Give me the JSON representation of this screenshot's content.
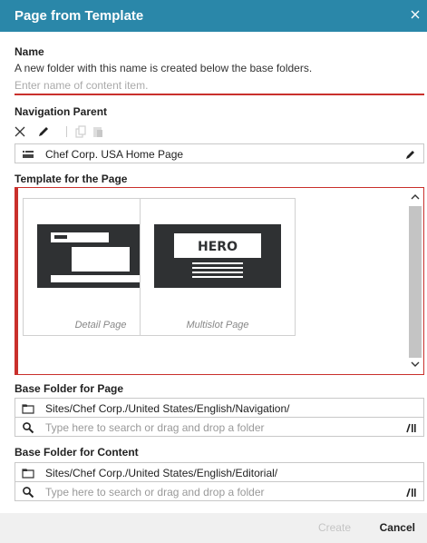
{
  "dialog": {
    "title": "Page from Template"
  },
  "name": {
    "label": "Name",
    "hint": "A new folder with this name is created below the base folders.",
    "placeholder": "Enter name of content item."
  },
  "navigation_parent": {
    "label": "Navigation Parent",
    "value": "Chef Corp. USA Home Page"
  },
  "template": {
    "label": "Template for the Page",
    "cards": [
      {
        "caption": "Detail Page"
      },
      {
        "caption": "Multislot Page",
        "hero_text": "HERO"
      }
    ]
  },
  "base_folder_page": {
    "label": "Base Folder for Page",
    "path": "Sites/Chef Corp./United States/English/Navigation/",
    "search_placeholder": "Type here to search or drag and drop a folder"
  },
  "base_folder_content": {
    "label": "Base Folder for Content",
    "path": "Sites/Chef Corp./United States/English/Editorial/",
    "search_placeholder": "Type here to search or drag and drop a folder"
  },
  "footer": {
    "create_label": "Create",
    "cancel_label": "Cancel"
  }
}
